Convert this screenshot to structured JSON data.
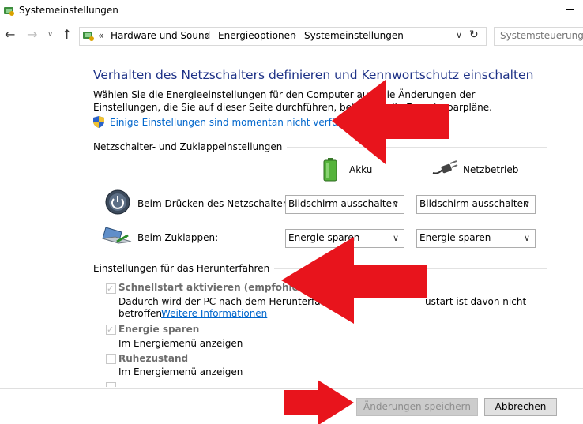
{
  "window": {
    "title": "Systemeinstellungen"
  },
  "nav": {
    "breadcrumb_prefix": "«",
    "breadcrumbs": [
      "Hardware und Sound",
      "Energieoptionen",
      "Systemeinstellungen"
    ],
    "separator": "›",
    "search_placeholder": "Systemsteuerung du"
  },
  "main": {
    "title": "Verhalten des Netzschalters definieren und Kennwortschutz einschalten",
    "intro": "Wählen Sie die Energieeinstellungen für den Computer aus. Die Änderungen der Einstellungen, die Sie auf dieser Seite durchführen, betreffen alle Energiesparpläne.",
    "unavailable_link": "Einige Einstellungen sind momentan nicht verfügbar.",
    "section1": {
      "label": "Netzschalter- und Zuklappeinstellungen",
      "col_battery": "Akku",
      "col_power": "Netzbetrieb",
      "rows": [
        {
          "label": "Beim Drücken des Netzschalters:",
          "battery": "Bildschirm ausschalten",
          "power": "Bildschirm ausschalten"
        },
        {
          "label": "Beim Zuklappen:",
          "battery": "Energie sparen",
          "power": "Energie sparen"
        }
      ]
    },
    "section2": {
      "label": "Einstellungen für das Herunterfahren",
      "fast_startup": {
        "title": "Schnellstart aktivieren (empfohlen)",
        "desc_line1": "Dadurch wird der PC nach dem Herunterfahren",
        "desc_line1_end": "ustart ist davon nicht",
        "desc_line2": "betroffen.",
        "more_info": "Weitere Informationen",
        "checked": true
      },
      "sleep": {
        "title": "Energie sparen",
        "desc": "Im Energiemenü anzeigen",
        "checked": true
      },
      "hibernate": {
        "title": "Ruhezustand",
        "desc": "Im Energiemenü anzeigen",
        "checked": false
      }
    }
  },
  "footer": {
    "save": "Änderungen speichern",
    "cancel": "Abbrechen"
  },
  "colors": {
    "title_blue": "#1e3287",
    "link_blue": "#0066cc",
    "arrow_red": "#e8141c"
  }
}
